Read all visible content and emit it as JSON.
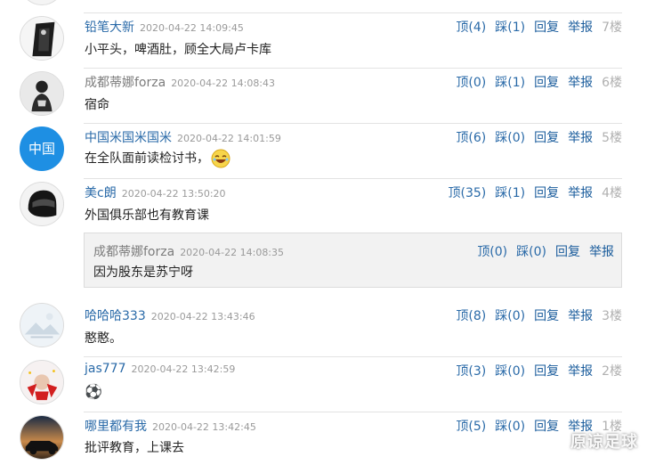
{
  "comments": [
    {
      "user": "铅笔大新",
      "time": "2020-04-22  14:09:45",
      "text": "小平头，啤酒肚，顾全大局卢卡库",
      "up": "顶(4)",
      "down": "踩(1)",
      "reply": "回复",
      "report": "举报",
      "floor": "7楼"
    },
    {
      "user": "成都蒂娜forza",
      "time": "2020-04-22  14:08:43",
      "text": "宿命",
      "up": "顶(0)",
      "down": "踩(1)",
      "reply": "回复",
      "report": "举报",
      "floor": "6楼"
    },
    {
      "user": "中国米国米国米",
      "time": "2020-04-22  14:01:59",
      "text": "在全队面前读检讨书，",
      "up": "顶(6)",
      "down": "踩(0)",
      "reply": "回复",
      "report": "举报",
      "floor": "5楼",
      "avatar_text": "中国"
    },
    {
      "user": "美c朗",
      "time": "2020-04-22  13:50:20",
      "text": "外国俱乐部也有教育课",
      "up": "顶(35)",
      "down": "踩(1)",
      "reply": "回复",
      "report": "举报",
      "floor": "4楼"
    },
    {
      "user": "哈哈哈333",
      "time": "2020-04-22  13:43:46",
      "text": "憨憨。",
      "up": "顶(8)",
      "down": "踩(0)",
      "reply": "回复",
      "report": "举报",
      "floor": "3楼"
    },
    {
      "user": "jas777",
      "time": "2020-04-22  13:42:59",
      "text": "⚽",
      "up": "顶(3)",
      "down": "踩(0)",
      "reply": "回复",
      "report": "举报",
      "floor": "2楼"
    },
    {
      "user": "哪里都有我",
      "time": "2020-04-22  13:42:45",
      "text": "批评教育，上课去",
      "up": "顶(5)",
      "down": "踩(0)",
      "reply": "回复",
      "report": "举报",
      "floor": "1楼"
    }
  ],
  "sub_reply": {
    "user": "成都蒂娜forza",
    "time": "2020-04-22  14:08:35",
    "text": "因为股东是苏宁呀",
    "up": "顶(0)",
    "down": "踩(0)",
    "reply": "回复",
    "report": "举报"
  },
  "watermark": "原谅足球",
  "colors": {
    "link": "#2a6aa8",
    "muted": "#9a9a9a",
    "floor": "#b0b0b0",
    "sub_bg": "#f2f2f2"
  }
}
